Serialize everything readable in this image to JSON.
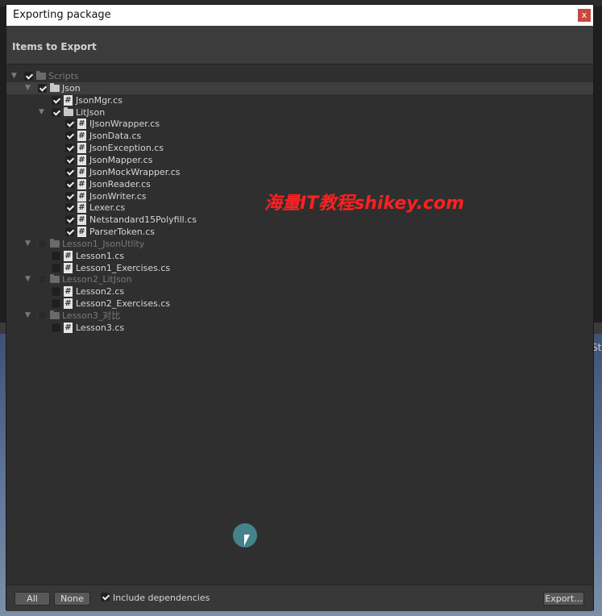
{
  "window": {
    "title": "Exporting package",
    "close_label": "x"
  },
  "header": {
    "title": "Items to Export"
  },
  "watermark": "海量IT教程shikey.com",
  "edge_text": "St",
  "tree": [
    {
      "label": "Scripts",
      "kind": "folder",
      "checked": true,
      "depth": 0,
      "dim": true,
      "highlight": false
    },
    {
      "label": "Json",
      "kind": "folder",
      "checked": true,
      "depth": 1,
      "dim": false,
      "highlight": true
    },
    {
      "label": "JsonMgr.cs",
      "kind": "file",
      "checked": true,
      "depth": 2,
      "dim": false
    },
    {
      "label": "LitJson",
      "kind": "folder",
      "checked": true,
      "depth": 2,
      "dim": false
    },
    {
      "label": "IJsonWrapper.cs",
      "kind": "file",
      "checked": true,
      "depth": 3,
      "dim": false
    },
    {
      "label": "JsonData.cs",
      "kind": "file",
      "checked": true,
      "depth": 3,
      "dim": false
    },
    {
      "label": "JsonException.cs",
      "kind": "file",
      "checked": true,
      "depth": 3,
      "dim": false
    },
    {
      "label": "JsonMapper.cs",
      "kind": "file",
      "checked": true,
      "depth": 3,
      "dim": false
    },
    {
      "label": "JsonMockWrapper.cs",
      "kind": "file",
      "checked": true,
      "depth": 3,
      "dim": false
    },
    {
      "label": "JsonReader.cs",
      "kind": "file",
      "checked": true,
      "depth": 3,
      "dim": false
    },
    {
      "label": "JsonWriter.cs",
      "kind": "file",
      "checked": true,
      "depth": 3,
      "dim": false
    },
    {
      "label": "Lexer.cs",
      "kind": "file",
      "checked": true,
      "depth": 3,
      "dim": false
    },
    {
      "label": "Netstandard15Polyfill.cs",
      "kind": "file",
      "checked": true,
      "depth": 3,
      "dim": false
    },
    {
      "label": "ParserToken.cs",
      "kind": "file",
      "checked": true,
      "depth": 3,
      "dim": false
    },
    {
      "label": "Lesson1_JsonUtlity",
      "kind": "folder",
      "checked": false,
      "depth": 1,
      "dim": true
    },
    {
      "label": "Lesson1.cs",
      "kind": "file",
      "checked": false,
      "depth": 2,
      "dim": false
    },
    {
      "label": "Lesson1_Exercises.cs",
      "kind": "file",
      "checked": false,
      "depth": 2,
      "dim": false
    },
    {
      "label": "Lesson2_LitJson",
      "kind": "folder",
      "checked": false,
      "depth": 1,
      "dim": true
    },
    {
      "label": "Lesson2.cs",
      "kind": "file",
      "checked": false,
      "depth": 2,
      "dim": false
    },
    {
      "label": "Lesson2_Exercises.cs",
      "kind": "file",
      "checked": false,
      "depth": 2,
      "dim": false
    },
    {
      "label": "Lesson3_对比",
      "kind": "folder",
      "checked": false,
      "depth": 1,
      "dim": true
    },
    {
      "label": "Lesson3.cs",
      "kind": "file",
      "checked": false,
      "depth": 2,
      "dim": false
    }
  ],
  "footer": {
    "all_label": "All",
    "none_label": "None",
    "include_dependencies_label": "Include dependencies",
    "include_dependencies_checked": true,
    "export_label": "Export..."
  }
}
